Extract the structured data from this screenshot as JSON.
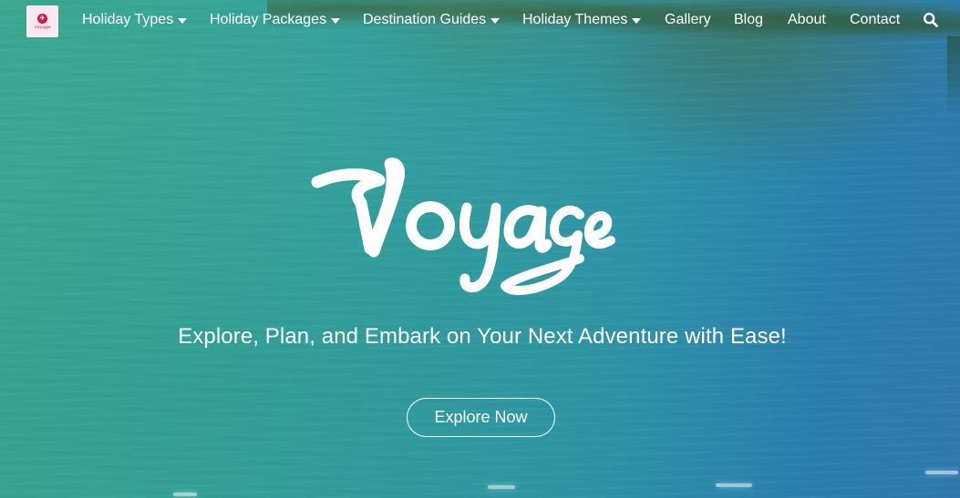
{
  "brand": {
    "logo_icon": "voyage-logo-icon",
    "logo_text": "voyage",
    "logo_bg": "#fce8ee",
    "logo_accent": "#d8184a",
    "script_title": "Voyage"
  },
  "nav": {
    "items": [
      {
        "label": "Holiday Types",
        "dropdown": true
      },
      {
        "label": "Holiday Packages",
        "dropdown": true
      },
      {
        "label": "Destination Guides",
        "dropdown": true
      },
      {
        "label": "Holiday Themes",
        "dropdown": true
      },
      {
        "label": "Gallery",
        "dropdown": false
      },
      {
        "label": "Blog",
        "dropdown": false
      },
      {
        "label": "About",
        "dropdown": false
      },
      {
        "label": "Contact",
        "dropdown": false
      }
    ],
    "search_icon": "search-icon",
    "dropdown_icon": "caret-down-icon"
  },
  "hero": {
    "tagline": "Explore, Plan, and Embark on Your Next Adventure with Ease!",
    "cta_label": "Explore Now",
    "background": "aerial-ocean-photo",
    "colors": {
      "water_left": "#3aa88f",
      "water_right": "#2d78b0",
      "text": "#ffffff"
    }
  }
}
